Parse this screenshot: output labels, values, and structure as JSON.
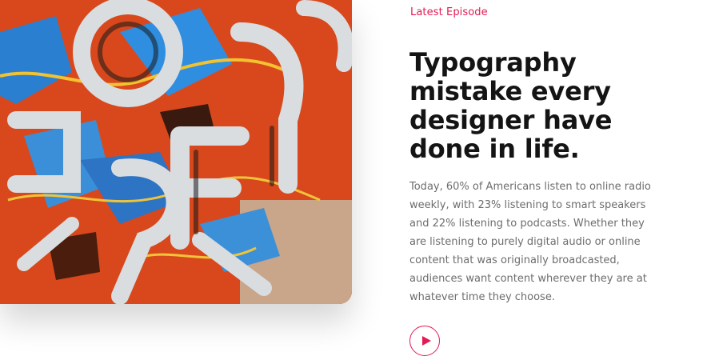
{
  "colors": {
    "accent": "#e31b54",
    "heading": "#141414",
    "body_text": "#6d6d6d"
  },
  "episode": {
    "kicker": "Latest Episode",
    "title": "Typography mistake every designer have done in life.",
    "description": "Today, 60% of Americans listen to online radio weekly, with 23% listening to smart speakers and 22% listening to podcasts. Whether they are listening to purely digital audio or online content that was originally broadcasted, audiences want content wherever they are at whatever time they choose.",
    "play_icon": "play-icon",
    "image_icon": "typography-letters-image"
  }
}
